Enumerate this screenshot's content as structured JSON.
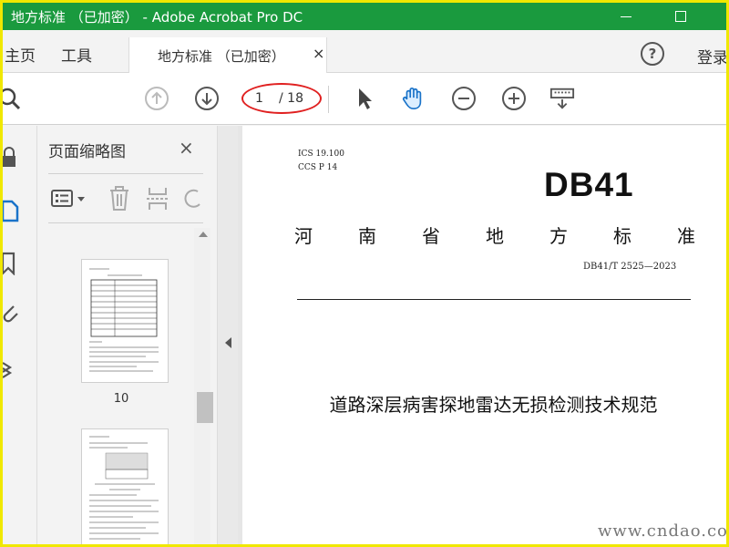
{
  "window": {
    "title": "地方标准 （已加密） - Adobe Acrobat Pro DC",
    "title_color": "#1a9a3e"
  },
  "tabs": {
    "home": "主页",
    "tools": "工具",
    "document": "地方标准 （已加密）",
    "close": "×",
    "help": "?",
    "login": "登录"
  },
  "toolbar": {
    "current_page": "1",
    "page_total": "/ 18",
    "icons": [
      "search-icon",
      "page-up-icon",
      "page-down-icon",
      "select-arrow-icon",
      "hand-tool-icon",
      "zoom-out-icon",
      "zoom-in-icon",
      "keyboard-icon"
    ]
  },
  "panel": {
    "title": "页面缩略图",
    "close": "×",
    "thumbnails": [
      {
        "label": "10"
      },
      {
        "label": ""
      }
    ]
  },
  "document": {
    "ics": "ICS 19.100",
    "ccs": "CCS P 14",
    "logo": "DB41",
    "province_chars": [
      "河",
      "南",
      "省",
      "地",
      "方",
      "标",
      "准"
    ],
    "standard_number": "DB41/T 2525—2023",
    "title": "道路深层病害探地雷达无损检测技术规范"
  },
  "watermark": {
    "footer": "www.cndao.com"
  }
}
